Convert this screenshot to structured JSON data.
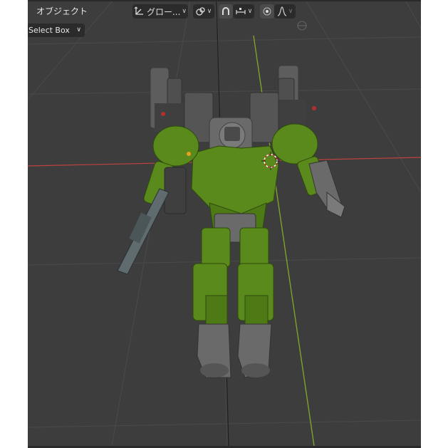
{
  "header": {
    "mode_label": "オブジェクト",
    "transform_orientation": "グロー...",
    "select_mode": "Select Box"
  },
  "colors": {
    "viewport_bg": "#3d3d3d",
    "grid_line": "#555555",
    "x_axis": "#c2423f",
    "y_axis": "#7fa22a",
    "robot_green": "#5a8a1c",
    "robot_gray": "#5e5e5e"
  },
  "icons": [
    "transform-pivot-icon",
    "snap-link-icon",
    "snap-magnet-icon",
    "snap-increment-icon",
    "proportional-edit-icon",
    "falloff-curve-icon"
  ]
}
